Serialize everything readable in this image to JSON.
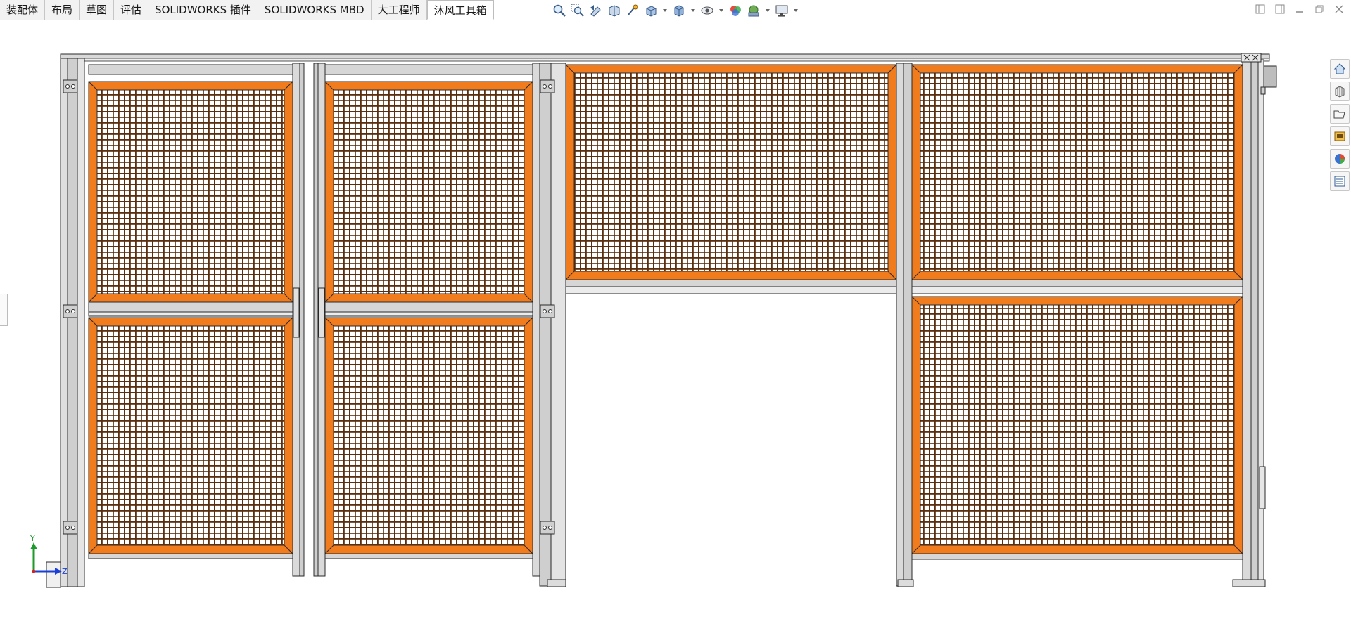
{
  "command_manager": {
    "tabs": [
      {
        "label": "装配体",
        "active": false
      },
      {
        "label": "布局",
        "active": false
      },
      {
        "label": "草图",
        "active": false
      },
      {
        "label": "评估",
        "active": false
      },
      {
        "label": "SOLIDWORKS 插件",
        "active": false
      },
      {
        "label": "SOLIDWORKS MBD",
        "active": false
      },
      {
        "label": "大工程师",
        "active": false
      },
      {
        "label": "沐风工具箱",
        "active": true
      }
    ]
  },
  "heads_up_toolbar": {
    "icons": [
      "zoom-to-fit-icon",
      "zoom-to-area-icon",
      "previous-view-icon",
      "section-view-icon",
      "dynamic-annotation-icon",
      "view-orientation-icon",
      "display-style-icon",
      "hide-show-items-icon",
      "edit-appearance-icon",
      "apply-scene-icon",
      "view-settings-icon"
    ]
  },
  "window_controls": {
    "icons": [
      "tile-left-icon",
      "tile-right-icon",
      "minimize-icon",
      "restore-icon",
      "close-icon"
    ]
  },
  "task_pane": {
    "icons": [
      "solidworks-resources-icon",
      "design-library-icon",
      "file-explorer-icon",
      "view-palette-icon",
      "appearances-icon",
      "custom-properties-icon"
    ]
  },
  "triad": {
    "y_label": "Y",
    "z_label": "Z"
  },
  "colors": {
    "frame_orange": "#f07c1e",
    "mesh_dark": "#5a2e0e",
    "profile_gray": "#d9d9d9",
    "outline": "#2a2a2a",
    "triad_y": "#1c9a2a",
    "triad_z": "#1a3fd6",
    "triad_x": "#d22020"
  }
}
